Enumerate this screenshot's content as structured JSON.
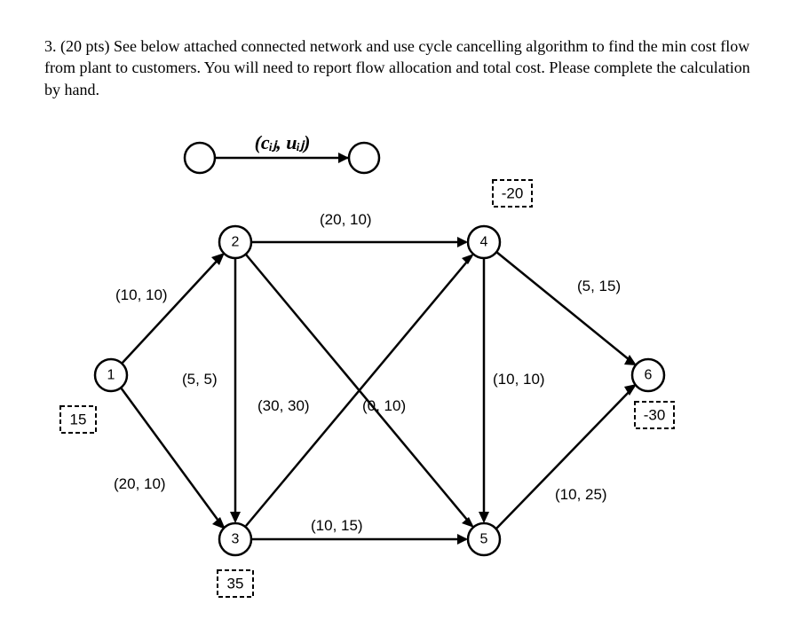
{
  "question": {
    "number": "3.",
    "points": "(20 pts)",
    "body": "See below attached connected network and use cycle cancelling algorithm to find the min cost flow from plant to customers. You will need to report flow allocation and total cost. Please complete the calculation by hand."
  },
  "legend": {
    "label": "(cᵢⱼ, uᵢⱼ)"
  },
  "chart_data": {
    "type": "network",
    "nodes": [
      {
        "id": "1",
        "label": "1",
        "supply": 15
      },
      {
        "id": "2",
        "label": "2",
        "supply": 0
      },
      {
        "id": "3",
        "label": "3",
        "supply": 35
      },
      {
        "id": "4",
        "label": "4",
        "supply": -20
      },
      {
        "id": "5",
        "label": "5",
        "supply": 0
      },
      {
        "id": "6",
        "label": "6",
        "supply": -30
      }
    ],
    "edges": [
      {
        "from": "1",
        "to": "2",
        "cost": 10,
        "cap": 10,
        "label": "(10, 10)"
      },
      {
        "from": "1",
        "to": "3",
        "cost": 20,
        "cap": 10,
        "label": "(20, 10)"
      },
      {
        "from": "2",
        "to": "3",
        "cost": 5,
        "cap": 5,
        "label": "(5, 5)"
      },
      {
        "from": "2",
        "to": "4",
        "cost": 20,
        "cap": 10,
        "label": "(20, 10)"
      },
      {
        "from": "2",
        "to": "5",
        "cost": 0,
        "cap": 10,
        "label": "(0, 10)"
      },
      {
        "from": "3",
        "to": "4",
        "cost": 30,
        "cap": 30,
        "label": "(30, 30)"
      },
      {
        "from": "3",
        "to": "5",
        "cost": 10,
        "cap": 15,
        "label": "(10, 15)"
      },
      {
        "from": "4",
        "to": "5",
        "cost": 10,
        "cap": 10,
        "label": "(10, 10)"
      },
      {
        "from": "4",
        "to": "6",
        "cost": 5,
        "cap": 15,
        "label": "(5, 15)"
      },
      {
        "from": "5",
        "to": "6",
        "cost": 10,
        "cap": 25,
        "label": "(10, 25)"
      }
    ],
    "supply_boxes": {
      "1": "15",
      "3": "35",
      "4": "-20",
      "6": "-30"
    }
  }
}
